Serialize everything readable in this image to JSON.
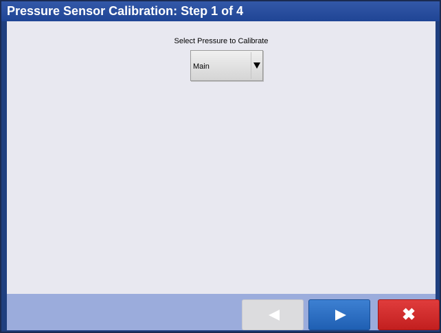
{
  "window": {
    "title": "Pressure Sensor Calibration: Step 1 of 4"
  },
  "form": {
    "select_label": "Select Pressure to Calibrate",
    "pressure_dropdown": {
      "selected": "Main"
    }
  },
  "footer": {
    "back_icon": "left-arrow-icon",
    "back_enabled": false,
    "next_icon": "right-arrow-icon",
    "cancel_icon": "x-icon",
    "cancel_glyph": "✖"
  },
  "colors": {
    "titlebar": "#1f4595",
    "content": "#e8e8f0",
    "footer": "#9bacdc",
    "next_button": "#1f5fb3",
    "cancel_button": "#c21f1f",
    "back_button_disabled": "#dcdcde"
  }
}
